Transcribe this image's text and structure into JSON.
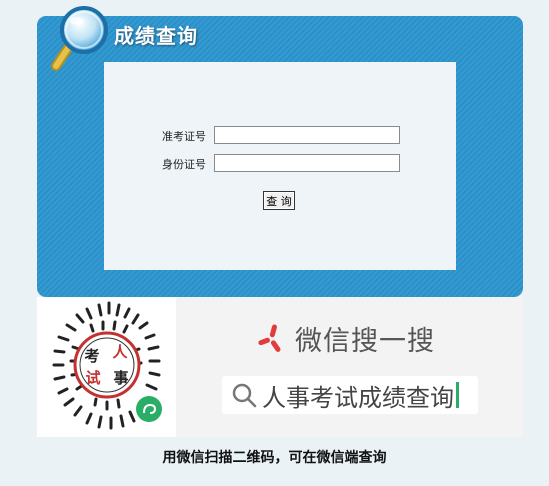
{
  "panel": {
    "title": "成绩查询"
  },
  "form": {
    "exam_id_label": "准考证号",
    "exam_id_value": "",
    "id_card_label": "身份证号",
    "id_card_value": "",
    "submit_label": "查 询"
  },
  "wechat": {
    "qr_text_1": "考",
    "qr_text_2": "人",
    "qr_text_3": "试",
    "qr_text_4": "事",
    "brand_label": "微信搜一搜",
    "search_text": "人事考试成绩查询"
  },
  "footer": {
    "text": "用微信扫描二维码，可在微信端查询"
  },
  "colors": {
    "panel": "#2b95cf",
    "accent_red": "#e23b3b",
    "wechat_green": "#2aae67"
  }
}
